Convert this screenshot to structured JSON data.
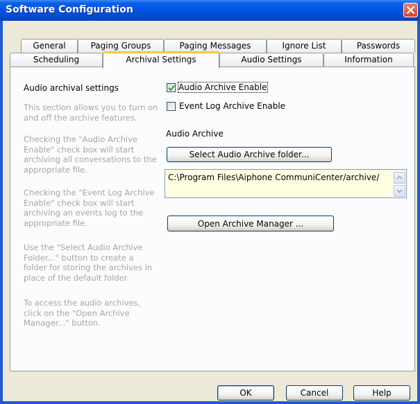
{
  "window": {
    "title": "Software Configuration"
  },
  "tabs_back": [
    {
      "label": "General"
    },
    {
      "label": "Paging Groups"
    },
    {
      "label": "Paging Messages"
    },
    {
      "label": "Ignore List"
    },
    {
      "label": "Passwords"
    }
  ],
  "tabs_front": [
    {
      "label": "Scheduling"
    },
    {
      "label": "Archival Settings",
      "active": true
    },
    {
      "label": "Audio Settings"
    },
    {
      "label": "Information"
    }
  ],
  "section": {
    "title": "Audio archival settings",
    "help": [
      "This section allows you to turn on\nand off the archive features.",
      "Checking the \"Audio Archive\nEnable\" check box will start\narchiving all conversations to the\nappropriate file.",
      "Checking the \"Event Log Archive\nEnable\" check box will start\narchiving an events log to the\nappropriate file.",
      "Use the \"Select Audio Archive\nFolder...\" button to create a\nfolder for storing the archives in\nplace of the default folder.",
      "To access the audio archives,\nclick on the \"Open Archive\nManager...\" button."
    ]
  },
  "options": {
    "audio_archive_enable": {
      "label": "Audio Archive Enable",
      "checked": true
    },
    "event_log_archive_enable": {
      "label": "Event Log Archive Enable",
      "checked": false
    }
  },
  "audio_archive": {
    "label": "Audio Archive",
    "select_button": "Select Audio Archive folder...",
    "path": "C:\\Program Files\\Aiphone CommuniCenter/archive/",
    "open_manager_button": "Open Archive Manager ..."
  },
  "footer": {
    "ok": "OK",
    "cancel": "Cancel",
    "help": "Help"
  }
}
